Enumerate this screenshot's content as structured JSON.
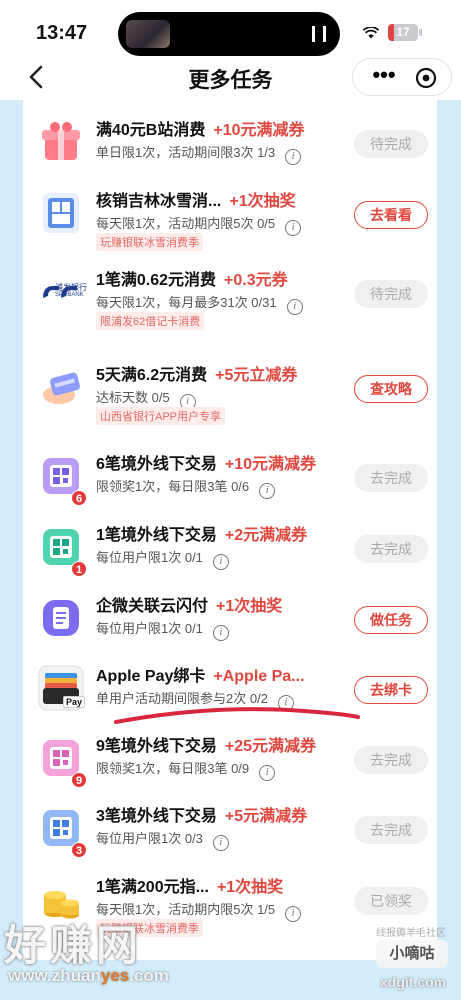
{
  "status_bar": {
    "time": "13:47",
    "battery": "17"
  },
  "nav": {
    "title": "更多任务",
    "more": "•••"
  },
  "colors": {
    "accent": "#e0483f",
    "background": "#d2ecfb",
    "annotation_stroke": "#d8263d"
  },
  "tasks": [
    {
      "icon": "gift-box-icon",
      "title": "满40元B站消费",
      "reward": "+10元满减券",
      "desc": "单日限1次，活动期间限3次 1/3",
      "tag": "",
      "badge": "",
      "button": "待完成",
      "state": "done"
    },
    {
      "icon": "ice-snow-limit-icon",
      "title": "核销吉林冰雪消...",
      "reward": "+1次抽奖",
      "desc": "每天限1次，活动期内限5次 0/5",
      "tag": "玩赚银联冰雪消费季",
      "badge": "",
      "button": "去看看",
      "state": "go"
    },
    {
      "icon": "spd-bank-logo-icon",
      "title": "1笔满0.62元消费",
      "reward": "+0.3元券",
      "desc": "每天限1次，每月最多31次 0/31",
      "tag": "限浦发62借记卡消费",
      "badge": "",
      "button": "待完成",
      "state": "done"
    },
    {
      "icon": "card-hand-icon",
      "title": "5天满6.2元消费",
      "reward": "+5元立减券",
      "desc": "达标天数 0/5",
      "tag": "山西省银行APP用户专享",
      "badge": "",
      "button": "查攻略",
      "state": "go"
    },
    {
      "icon": "qr-code-purple-icon",
      "title": "6笔境外线下交易",
      "reward": "+10元满减券",
      "desc": "限领奖1次，每日限3笔 0/6",
      "tag": "",
      "badge": "6",
      "button": "去完成",
      "state": "done"
    },
    {
      "icon": "qr-code-green-icon",
      "title": "1笔境外线下交易",
      "reward": "+2元满减券",
      "desc": "每位用户限1次 0/1",
      "tag": "",
      "badge": "1",
      "button": "去完成",
      "state": "done"
    },
    {
      "icon": "document-purple-icon",
      "title": "企微关联云闪付",
      "reward": "+1次抽奖",
      "desc": "每位用户限1次 0/1",
      "tag": "",
      "badge": "",
      "button": "做任务",
      "state": "go"
    },
    {
      "icon": "apple-wallet-icon",
      "title": "Apple Pay绑卡",
      "reward": "+Apple Pa...",
      "desc": "单用户活动期间限参与2次 0/2",
      "tag": "",
      "badge": "",
      "button": "去绑卡",
      "state": "go"
    },
    {
      "icon": "qr-code-pink-icon",
      "title": "9笔境外线下交易",
      "reward": "+25元满减券",
      "desc": "限领奖1次，每日限3笔 0/9",
      "tag": "",
      "badge": "9",
      "button": "去完成",
      "state": "done"
    },
    {
      "icon": "qr-code-blue-icon",
      "title": "3笔境外线下交易",
      "reward": "+5元满减券",
      "desc": "每位用户限1次 0/3",
      "tag": "",
      "badge": "3",
      "button": "去完成",
      "state": "done"
    },
    {
      "icon": "gold-coins-icon",
      "title": "1笔满200元指...",
      "reward": "+1次抽奖",
      "desc": "每天限1次，活动期内限5次 1/5",
      "tag": "玩赚银联冰雪消费季",
      "badge": "",
      "button": "已领奖",
      "state": "done"
    }
  ],
  "icon_text": {
    "spd_bank_name": "浦发银行",
    "spd_bank_en": "SPDBANK",
    "apple_pay": "Pay"
  },
  "watermark": {
    "left_big": "好赚网",
    "left_url_a": "www.zhuan",
    "left_url_b": "yes",
    "left_url_c": ".com",
    "right_label": "线报薅羊毛社区",
    "right_name": "小嘀咕",
    "right_url": "xdgit.com"
  }
}
